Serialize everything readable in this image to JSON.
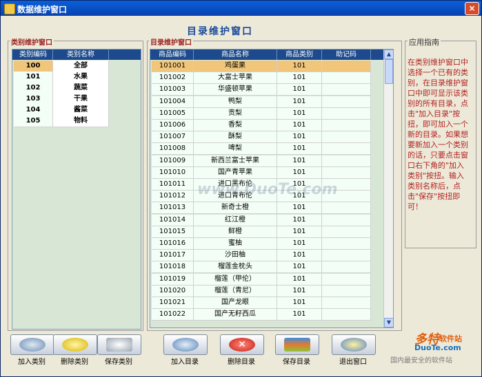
{
  "window": {
    "title": "数据维护窗口",
    "close_label": "×"
  },
  "main_title": "目录维护窗口",
  "category_panel": {
    "label": "类别维护窗口",
    "columns": [
      "类别编码",
      "类别名称"
    ],
    "rows": [
      {
        "code": "100",
        "name": "全部",
        "selected": true
      },
      {
        "code": "101",
        "name": "水果"
      },
      {
        "code": "102",
        "name": "蔬菜"
      },
      {
        "code": "103",
        "name": "干果"
      },
      {
        "code": "104",
        "name": "酱菜"
      },
      {
        "code": "105",
        "name": "物料"
      }
    ]
  },
  "catalog_panel": {
    "label": "目录维护窗口",
    "columns": [
      "商品编码",
      "商品名称",
      "商品类别",
      "助记码"
    ],
    "rows": [
      {
        "code": "101001",
        "name": "鸡蛋果",
        "category": "101",
        "mnemonic": "",
        "selected": true
      },
      {
        "code": "101002",
        "name": "大富士苹果",
        "category": "101",
        "mnemonic": ""
      },
      {
        "code": "101003",
        "name": "华盛顿苹果",
        "category": "101",
        "mnemonic": ""
      },
      {
        "code": "101004",
        "name": "鸭梨",
        "category": "101",
        "mnemonic": ""
      },
      {
        "code": "101005",
        "name": "贡梨",
        "category": "101",
        "mnemonic": ""
      },
      {
        "code": "101006",
        "name": "香梨",
        "category": "101",
        "mnemonic": ""
      },
      {
        "code": "101007",
        "name": "酥梨",
        "category": "101",
        "mnemonic": ""
      },
      {
        "code": "101008",
        "name": "啤梨",
        "category": "101",
        "mnemonic": ""
      },
      {
        "code": "101009",
        "name": "新西兰富士苹果",
        "category": "101",
        "mnemonic": ""
      },
      {
        "code": "101010",
        "name": "国产青苹果",
        "category": "101",
        "mnemonic": ""
      },
      {
        "code": "101011",
        "name": "进口黑布伦",
        "category": "101",
        "mnemonic": ""
      },
      {
        "code": "101012",
        "name": "进口青布伦",
        "category": "101",
        "mnemonic": ""
      },
      {
        "code": "101013",
        "name": "新奇士橙",
        "category": "101",
        "mnemonic": ""
      },
      {
        "code": "101014",
        "name": "红江橙",
        "category": "101",
        "mnemonic": ""
      },
      {
        "code": "101015",
        "name": "鲜橙",
        "category": "101",
        "mnemonic": ""
      },
      {
        "code": "101016",
        "name": "蜜柚",
        "category": "101",
        "mnemonic": ""
      },
      {
        "code": "101017",
        "name": "沙田柚",
        "category": "101",
        "mnemonic": ""
      },
      {
        "code": "101018",
        "name": "榴莲金枕头",
        "category": "101",
        "mnemonic": ""
      },
      {
        "code": "101019",
        "name": "榴莲（甲伦）",
        "category": "101",
        "mnemonic": ""
      },
      {
        "code": "101020",
        "name": "榴莲（青尼）",
        "category": "101",
        "mnemonic": ""
      },
      {
        "code": "101021",
        "name": "国产龙眼",
        "category": "101",
        "mnemonic": ""
      },
      {
        "code": "101022",
        "name": "国产无籽西瓜",
        "category": "101",
        "mnemonic": ""
      }
    ]
  },
  "guide": {
    "label": "应用指南",
    "text": "在类别维护窗口中选择一个已有的类别，在目录维护窗口中即可显示该类别的所有目录，点击\"加入目录\"按扭，即可加入一个新的目录。如果想要新加入一个类别的话，只要点击窗口右下角的\"加入类别\"按扭。输入类别名称后，点击\"保存\"按扭即可！"
  },
  "buttons": {
    "add_category": "加入类别",
    "delete_category": "删除类别",
    "save_category": "保存类别",
    "add_catalog": "加入目录",
    "delete_catalog": "删除目录",
    "save_catalog": "保存目录",
    "exit_window": "退出窗口"
  },
  "watermark": {
    "center": "www.DuoTe.com",
    "brand_cn": "多特",
    "brand_suffix": "软件站",
    "brand_en": "DuoTe.com",
    "slogan": "国内最安全的软件站"
  },
  "colors": {
    "title_bar": "#0a5fd8",
    "selected_row": "#f1c67a",
    "header": "#1c4a8c",
    "guide_text": "#b22222"
  }
}
